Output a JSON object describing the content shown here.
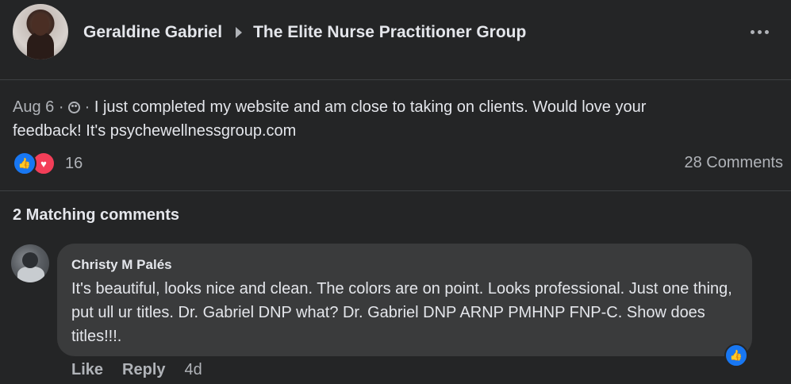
{
  "post": {
    "author": "Geraldine Gabriel",
    "group": "The Elite Nurse Practitioner Group",
    "date": "Aug 6",
    "separator": "·",
    "text_line1": "I just completed my website and am close to taking on clients. Would love your",
    "text_line2": "feedback! It's psychewellnessgroup.com",
    "reaction_count": "16",
    "comments_count": "28 Comments",
    "icons": {
      "audience": "group-icon",
      "more": "more-icon",
      "like": "like-icon",
      "love": "love-icon"
    }
  },
  "comments_section": {
    "title": "2 Matching comments",
    "comments": [
      {
        "author": "Christy M Palés",
        "text": "It's beautiful, looks nice and clean. The colors are on point. Looks professional. Just one thing, put ull ur titles. Dr. Gabriel DNP what? Dr. Gabriel DNP ARNP PMHNP FNP-C. Show does titles!!!.",
        "like_label": "Like",
        "reply_label": "Reply",
        "time": "4d"
      }
    ]
  },
  "colors": {
    "background": "#242526",
    "bubble": "#3a3b3c",
    "text_primary": "#e4e6eb",
    "text_secondary": "#b0b3b8",
    "like_blue": "#1877f2",
    "love_red": "#f33e58"
  }
}
